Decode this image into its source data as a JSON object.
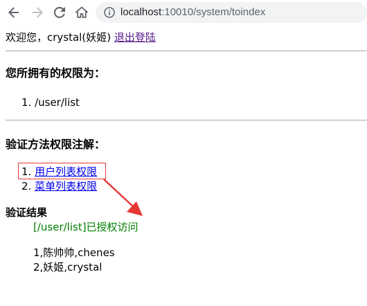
{
  "browser": {
    "url_host": "localhost",
    "url_port_path": ":10010/system/toindex"
  },
  "header": {
    "welcome_prefix": "欢迎您，crystal(妖姬)",
    "logout_label": "退出登陆"
  },
  "permissions": {
    "title": "您所拥有的权限为：",
    "items": [
      "1. /user/list"
    ]
  },
  "verify": {
    "title": "验证方法权限注解：",
    "items": [
      {
        "number": "1.",
        "label": "用户列表权限"
      },
      {
        "number": "2.",
        "label": "菜单列表权限"
      }
    ]
  },
  "result": {
    "title": "验证结果",
    "message": "[/user/list]已授权访问",
    "rows": [
      "1,陈帅帅,chenes",
      "2,妖姬,crystal"
    ]
  },
  "colors": {
    "annotation": "#e53935",
    "success_text": "#008000",
    "link": "#0000ee",
    "visited_link": "#551a8b"
  },
  "icons": {
    "back": "arrow-left",
    "forward": "arrow-right",
    "reload": "reload",
    "home": "home",
    "site_info": "info-circle"
  }
}
